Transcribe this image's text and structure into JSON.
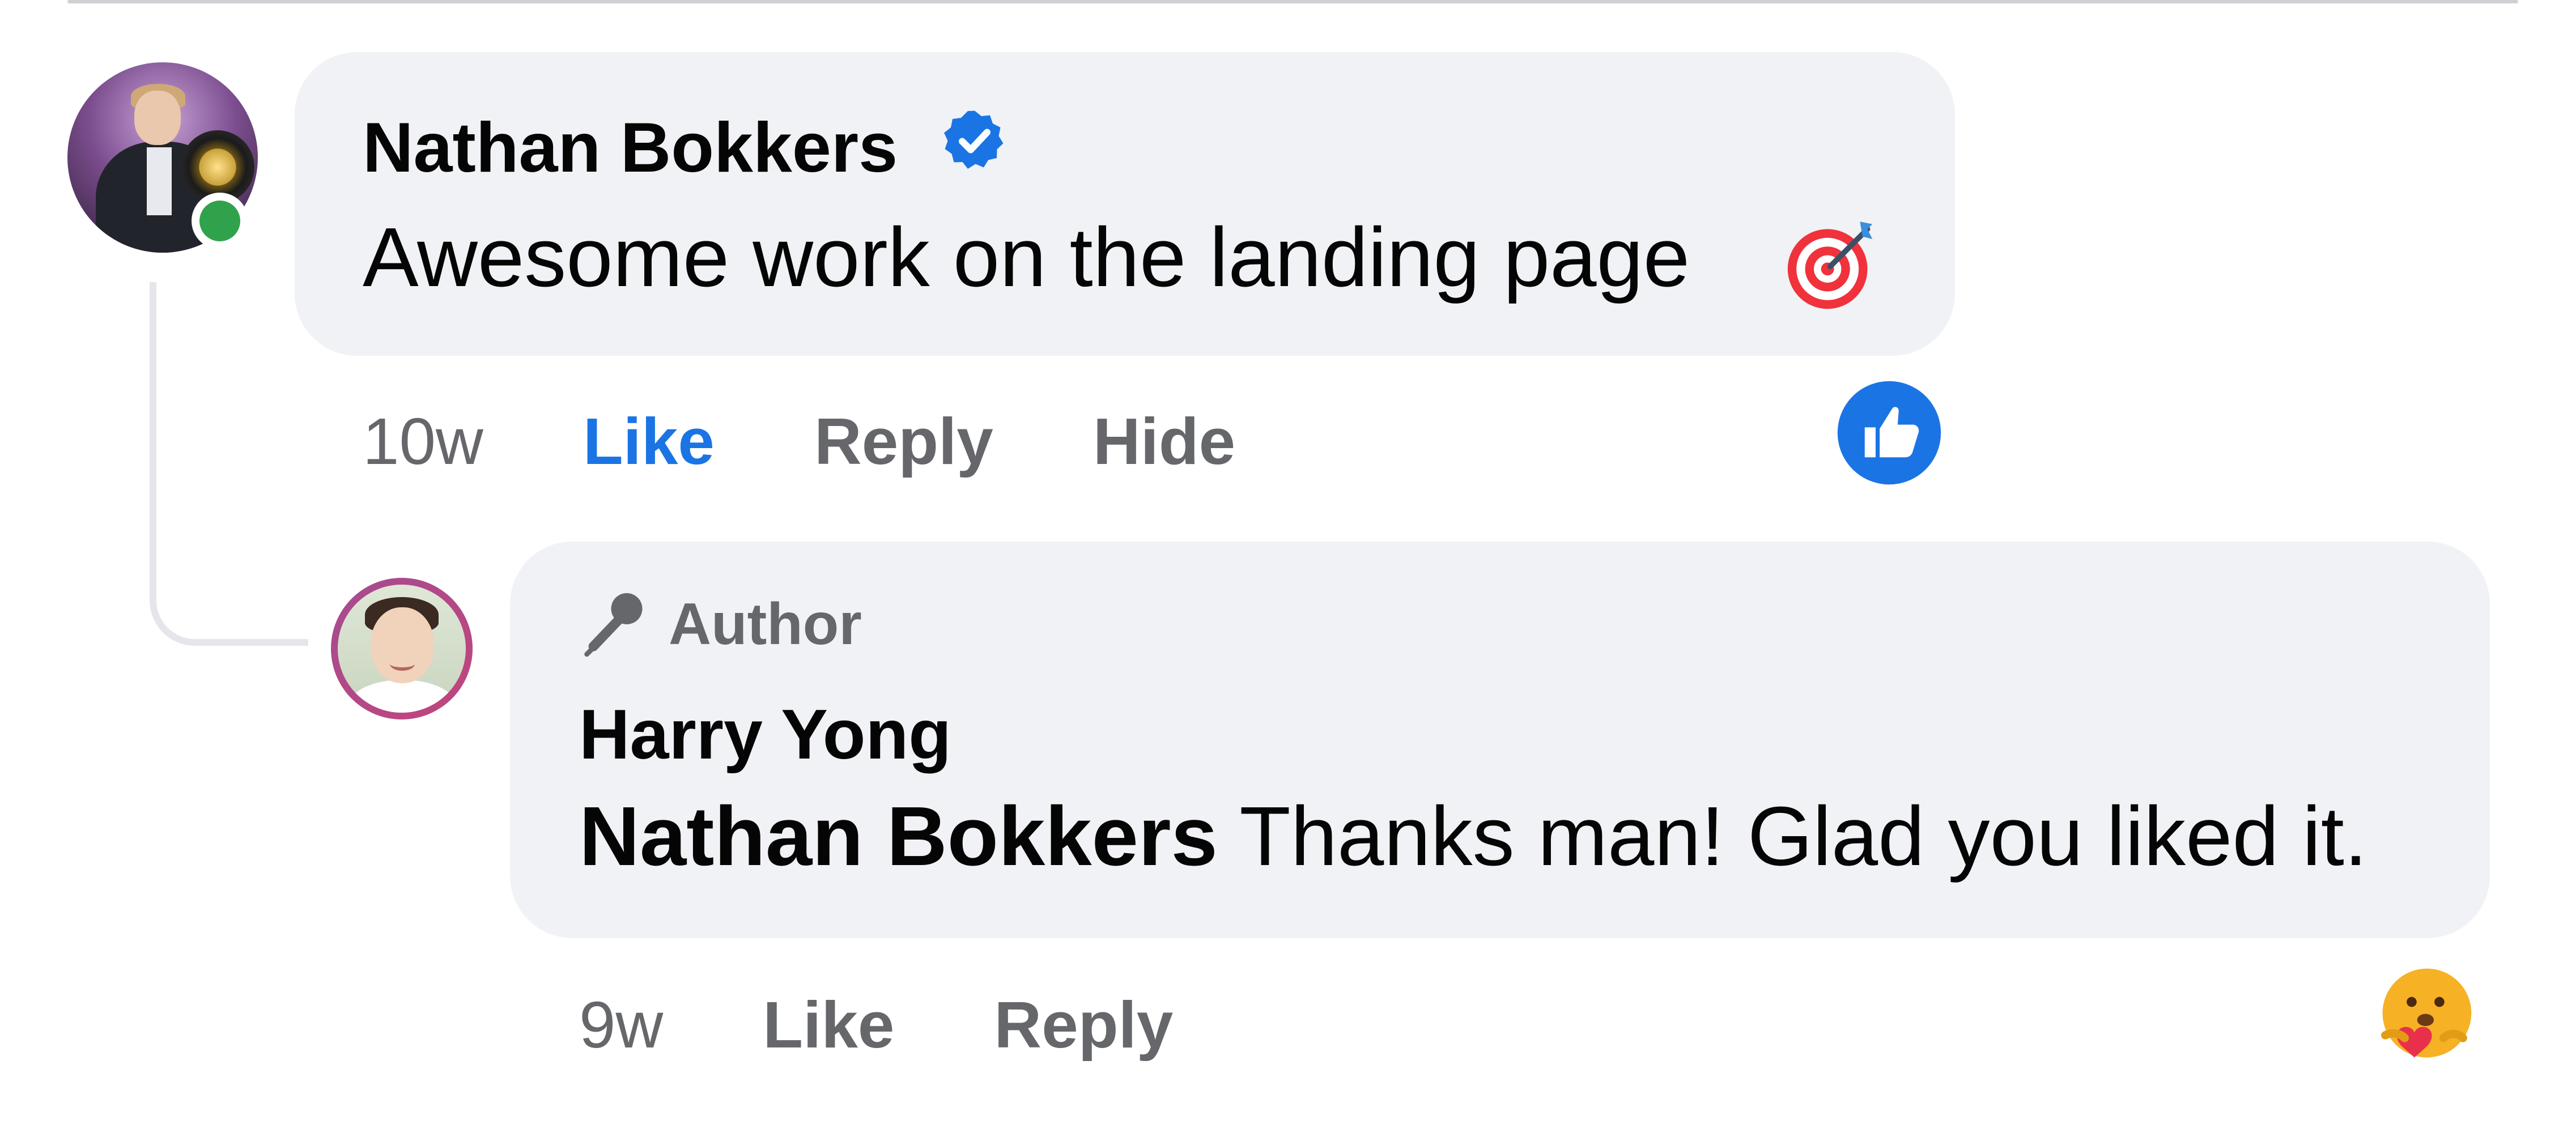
{
  "comment": {
    "author": "Nathan Bokkers",
    "verified": true,
    "text": "Awesome work on the landing page",
    "emoji": "direct-hit-target-emoji",
    "timestamp": "10w",
    "like_label": "Like",
    "reply_label": "Reply",
    "hide_label": "Hide",
    "like_active": true,
    "like_active_color": "#1b74e4",
    "online": true,
    "online_color": "#31a24c",
    "reaction": "like-reaction-icon"
  },
  "reply": {
    "badge_label": "Author",
    "badge_icon": "microphone-icon",
    "author": "Harry Yong",
    "mention": "Nathan Bokkers",
    "text": "Thanks man! Glad you liked it.",
    "timestamp": "9w",
    "like_label": "Like",
    "reply_label": "Reply",
    "reaction": "care-reaction-icon"
  },
  "colors": {
    "bubble_bg": "#f0f2f5",
    "text_primary": "#050505",
    "text_secondary": "#65676b",
    "thread_line": "#e4e6eb",
    "verified_blue": "#1b74e4"
  }
}
